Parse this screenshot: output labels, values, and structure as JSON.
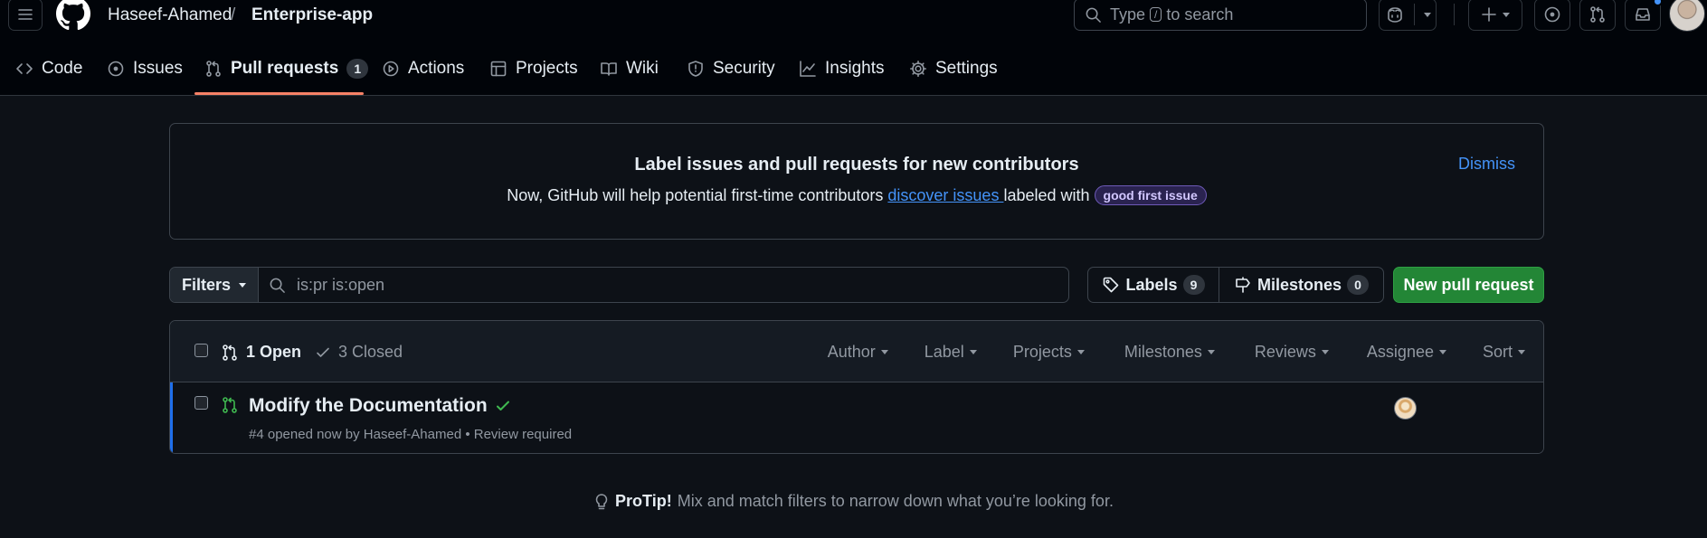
{
  "header": {
    "owner": "Haseef-Ahamed",
    "separator": "/",
    "repo": "Enterprise-app",
    "search_placeholder_pre": "Type",
    "search_key": "/",
    "search_placeholder_post": "to search"
  },
  "repo_nav": {
    "items": [
      {
        "label": "Code",
        "icon": "code-icon"
      },
      {
        "label": "Issues",
        "icon": "issue-opened-icon"
      },
      {
        "label": "Pull requests",
        "icon": "git-pull-request-icon",
        "count": "1",
        "active": true
      },
      {
        "label": "Actions",
        "icon": "play-icon"
      },
      {
        "label": "Projects",
        "icon": "table-icon"
      },
      {
        "label": "Wiki",
        "icon": "book-icon"
      },
      {
        "label": "Security",
        "icon": "shield-icon"
      },
      {
        "label": "Insights",
        "icon": "graph-icon"
      },
      {
        "label": "Settings",
        "icon": "gear-icon"
      }
    ]
  },
  "banner": {
    "title": "Label issues and pull requests for new contributors",
    "desc_pre": "Now, GitHub will help potential first-time contributors ",
    "desc_link": "discover issues ",
    "desc_post": " labeled with ",
    "label": "good first issue",
    "dismiss": "Dismiss"
  },
  "filters": {
    "button_label": "Filters",
    "query": "is:pr is:open",
    "labels_label": "Labels",
    "labels_count": "9",
    "milestones_label": "Milestones",
    "milestones_count": "0",
    "new_pr_label": "New pull request"
  },
  "table": {
    "open_label": "1 Open",
    "closed_label": "3 Closed",
    "sort_options": [
      "Author",
      "Label",
      "Projects",
      "Milestones",
      "Reviews",
      "Assignee",
      "Sort"
    ],
    "rows": [
      {
        "title": "Modify the Documentation",
        "meta": "#4 opened now by Haseef-Ahamed • Review required",
        "status": "check-passing"
      }
    ]
  },
  "protip": {
    "bold": "ProTip!",
    "text": "Mix and match filters to narrow down what you’re looking for."
  },
  "colors": {
    "background": "#0d1117",
    "header": "#010409",
    "accent_link": "#4493f8",
    "primary_button": "#238636",
    "active_tab_underline": "#f78166",
    "open_pr": "#3fb950"
  }
}
